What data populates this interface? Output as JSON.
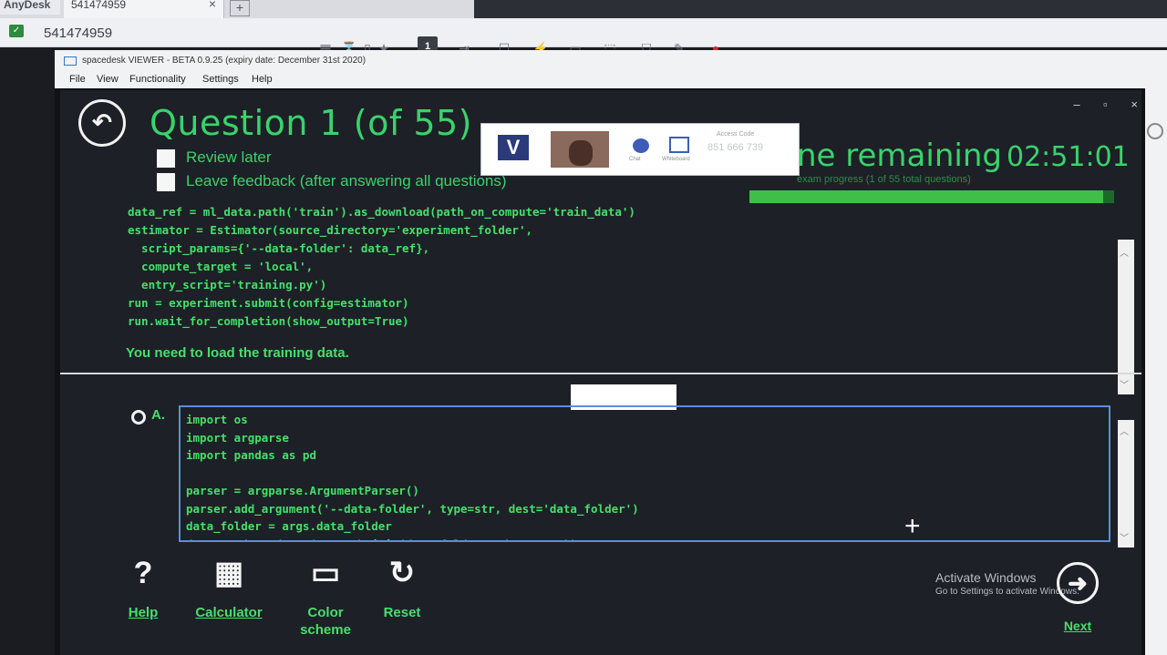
{
  "anydesk": {
    "brand": "AnyDesk",
    "tab_title": "541474959",
    "tab_close": "×",
    "new_tab": "+",
    "address": "541474959",
    "toolbar_active": "1"
  },
  "spacedesk": {
    "title": "spacedesk VIEWER - BETA 0.9.25 (expiry date: December 31st 2020)",
    "menu": [
      "File",
      "View",
      "Functionality",
      "Settings",
      "Help"
    ]
  },
  "window_controls": [
    "–",
    "▫",
    "×"
  ],
  "exam": {
    "question_title": "Question 1 (of 55)",
    "review_later": "Review later",
    "leave_feedback": "Leave feedback (after answering all questions)",
    "time_remaining_label": "ne remaining",
    "time_value": "02:51:01",
    "progress_label": "exam progress (1 of 55 total questions)",
    "progress_fraction": 0.97,
    "question_text": "You need to load the training data."
  },
  "overlay": {
    "access_code_label": "Access Code",
    "access_code": "851 666 739",
    "chat_label": "Chat",
    "whiteboard_label": "Whiteboard"
  },
  "question_code": [
    "data_ref = ml_data.path('train').as_download(path_on_compute='train_data')",
    "estimator = Estimator(source_directory='experiment_folder',",
    "  script_params={'--data-folder': data_ref},",
    "  compute_target = 'local',",
    "  entry_script='training.py')",
    "run = experiment.submit(config=estimator)",
    "run.wait_for_completion(show_output=True)"
  ],
  "answer_a": {
    "label": "A.",
    "code": [
      "import os",
      "import argparse",
      "import pandas as pd",
      "",
      "parser = argparse.ArgumentParser()",
      "parser.add_argument('--data-folder', type=str, dest='data_folder')",
      "data_folder = args.data_folder",
      "data = pd.read_csv(os.path.join(data_folder, 'data.csv'))"
    ]
  },
  "toolbar": {
    "help": "Help",
    "calculator": "Calculator",
    "color_scheme": "Color scheme",
    "reset": "Reset",
    "next": "Next"
  },
  "activate_windows": {
    "title": "Activate Windows",
    "subtitle": "Go to Settings to activate Windows."
  },
  "icons": {
    "back": "back-arrow-icon",
    "help": "question-icon",
    "calculator": "calculator-icon",
    "color_scheme": "monitor-icon",
    "reset": "reset-icon",
    "next": "next-arrow-icon"
  },
  "colors": {
    "accent_green": "#39d36b",
    "progress_fill": "#3fbf4a",
    "background": "#1d2027"
  }
}
